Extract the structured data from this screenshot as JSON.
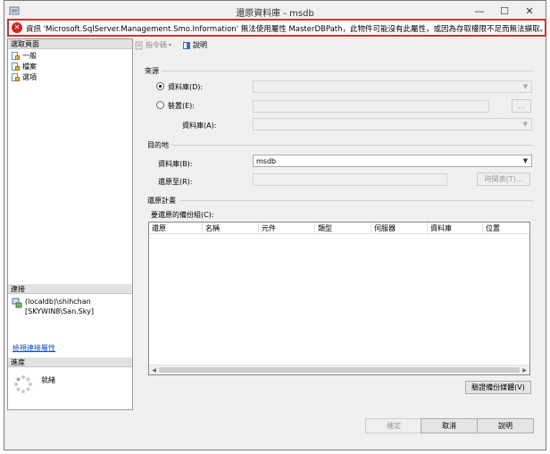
{
  "window": {
    "title": "還原資料庫 - msdb",
    "minimize": "—",
    "maximize": "☐",
    "close": "✕"
  },
  "error": {
    "icon": "error-icon",
    "message": "資訊 'Microsoft.SqlServer.Management.Smo.Information' 無法使用屬性 MasterDBPath，此物件可能沒有此屬性，或因為存取權限不足而無法擷取。"
  },
  "left": {
    "select_page_header": "選取頁面",
    "pages": [
      {
        "label": "一般",
        "icon": "page-icon"
      },
      {
        "label": "檔案",
        "icon": "page-icon"
      },
      {
        "label": "選項",
        "icon": "page-icon"
      }
    ],
    "connection_header": "連接",
    "connection_server": "(localdb)\\shihchan",
    "connection_user": "[SKYWIN8\\San.Sky]",
    "view_connection_link": "檢視連接屬性",
    "progress_header": "進度",
    "progress_status": "就緒"
  },
  "toolbar": {
    "script_label": "指令碼",
    "help_label": "說明"
  },
  "source": {
    "group_label": "來源",
    "database_radio": "資料庫(D):",
    "device_radio": "裝置(E):",
    "device_database_label": "資料庫(A):",
    "browse_label": "..."
  },
  "destination": {
    "group_label": "目的地",
    "database_label": "資料庫(B):",
    "database_value": "msdb",
    "restore_to_label": "還原至(R):",
    "timeline_button": "時間表(T)..."
  },
  "plan": {
    "group_label": "還原計畫",
    "backupsets_label": "要還原的備份組(C):",
    "columns": [
      "還原",
      "名稱",
      "元件",
      "類型",
      "伺服器",
      "資料庫",
      "位置"
    ],
    "verify_button": "驗證備份媒體(V)"
  },
  "footer": {
    "ok": "確定",
    "cancel": "取消",
    "help": "說明"
  }
}
